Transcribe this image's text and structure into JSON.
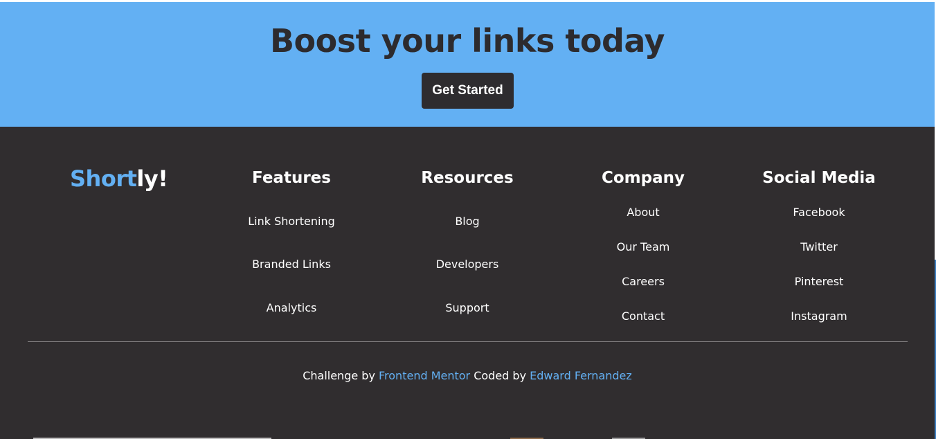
{
  "cta": {
    "title": "Boost your links today",
    "button_label": "Get Started"
  },
  "footer": {
    "logo_part1": "Short",
    "logo_part2": "ly!",
    "columns": [
      {
        "heading": "Features",
        "links": [
          "Link Shortening",
          "Branded Links",
          "Analytics"
        ]
      },
      {
        "heading": "Resources",
        "links": [
          "Blog",
          "Developers",
          "Support"
        ]
      },
      {
        "heading": "Company",
        "links": [
          "About",
          "Our Team",
          "Careers",
          "Contact"
        ]
      },
      {
        "heading": "Social Media",
        "links": [
          "Facebook",
          "Twitter",
          "Pinterest",
          "Instagram"
        ]
      }
    ],
    "credits": {
      "prefix": "Challenge by",
      "mentor_link": "Frontend Mentor",
      "middle": "Coded by",
      "author_link": "Edward Fernandez"
    }
  },
  "colors": {
    "cta_background": "#63b0f3",
    "footer_background": "#302d2f",
    "accent": "#63b0f3",
    "button_background": "#2e2c2f"
  }
}
